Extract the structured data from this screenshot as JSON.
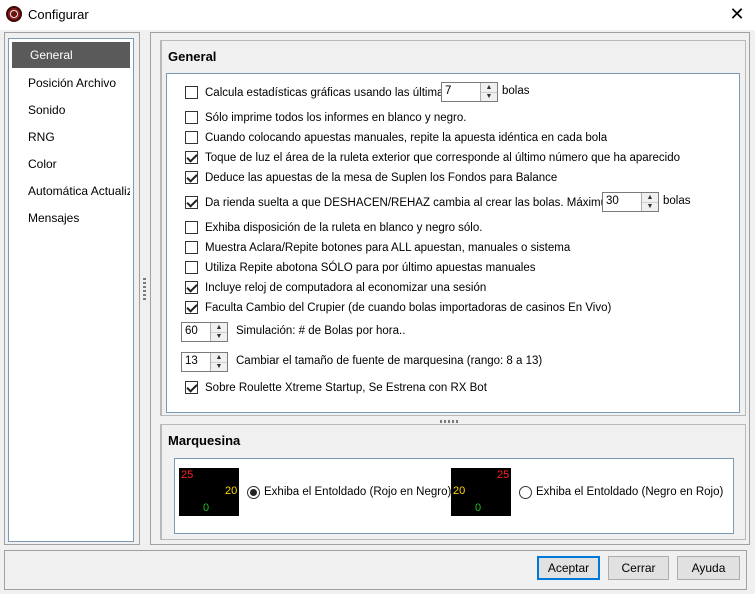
{
  "window": {
    "title": "Configurar",
    "close_glyph": "✕"
  },
  "nav": {
    "items": [
      {
        "label": "General",
        "selected": true
      },
      {
        "label": "Posición Archivo",
        "selected": false
      },
      {
        "label": "Sonido",
        "selected": false
      },
      {
        "label": "RNG",
        "selected": false
      },
      {
        "label": "Color",
        "selected": false
      },
      {
        "label": "Automática Actualización",
        "selected": false
      },
      {
        "label": "Mensajes",
        "selected": false
      }
    ]
  },
  "general": {
    "title": "General",
    "options": [
      {
        "checked": false,
        "label": "Calcula estadísticas gráficas usando las últimas",
        "spin_value": "7",
        "suffix": "bolas"
      },
      {
        "checked": false,
        "label": "Sólo imprime todos los informes en blanco y negro."
      },
      {
        "checked": false,
        "label": "Cuando colocando apuestas manuales, repite la apuesta idéntica en cada bola"
      },
      {
        "checked": true,
        "label": "Toque de luz el área de la ruleta exterior que corresponde al último número que ha aparecido"
      },
      {
        "checked": true,
        "label": "Deduce las apuestas de la mesa de Suplen los Fondos para Balance"
      },
      {
        "checked": true,
        "label": "Da rienda suelta a que DESHACEN/REHAZ cambia al crear las bolas.  Máximum:",
        "spin_value": "30",
        "suffix": "bolas"
      },
      {
        "checked": false,
        "label": "Exhiba disposición de la ruleta en blanco y negro sólo."
      },
      {
        "checked": false,
        "label": "Muestra Aclara/Repite botones para ALL apuestan, manuales o sistema"
      },
      {
        "checked": false,
        "label": "Utiliza Repite abotona SÓLO para por último apuestas manuales"
      },
      {
        "checked": true,
        "label": "Incluye reloj de computadora al economizar una sesión"
      },
      {
        "checked": true,
        "label": "Faculta Cambio del Crupier (de cuando bolas importadoras de casinos En Vivo)"
      }
    ],
    "spinners": [
      {
        "value": "60",
        "label": "Simulación: # de Bolas por hora.."
      },
      {
        "value": "13",
        "label": "Cambiar el tamaño de fuente de marquesina (rango: 8 a 13)"
      }
    ],
    "last_option": {
      "checked": true,
      "label": "Sobre Roulette Xtreme Startup, Se Estrena con RX Bot"
    }
  },
  "marquee": {
    "title": "Marquesina",
    "options": [
      {
        "selected": true,
        "label": "Exhiba el Entoldado (Rojo en Negro)",
        "preview": {
          "red": "25",
          "yellow": "20",
          "green": "0"
        }
      },
      {
        "selected": false,
        "label": "Exhiba el Entoldado (Negro en Rojo)",
        "preview": {
          "red": "25",
          "yellow": "20",
          "green": "0"
        }
      }
    ]
  },
  "buttons": {
    "accept": "Aceptar",
    "cancel": "Cerrar",
    "help": "Ayuda"
  },
  "colors": {
    "selected_nav_bg": "#5a5a5a",
    "focus_border": "#0078d7",
    "preview_red": "#ff2020",
    "preview_yellow": "#ffd800",
    "preview_green": "#20c020"
  }
}
